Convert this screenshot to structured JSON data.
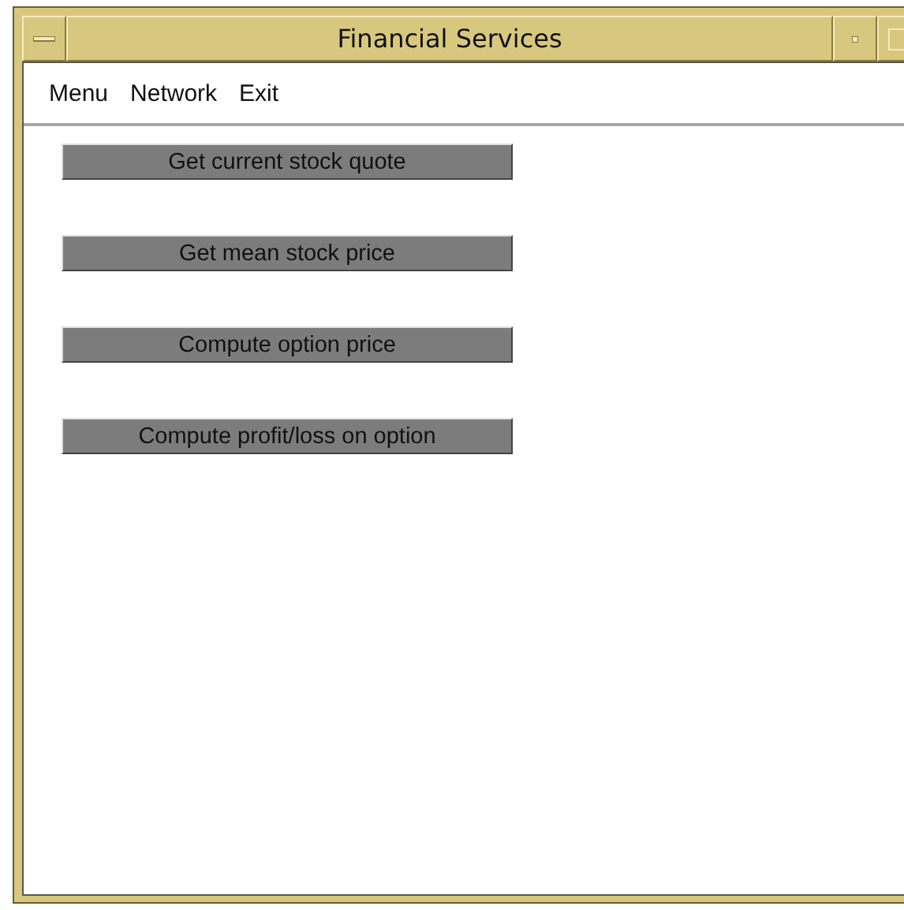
{
  "window": {
    "title": "Financial Services"
  },
  "menu": [
    "Menu",
    "Network",
    "Exit"
  ],
  "buttons": [
    "Get current stock quote",
    "Get mean stock price",
    "Compute option price",
    "Compute profit/loss on option"
  ]
}
